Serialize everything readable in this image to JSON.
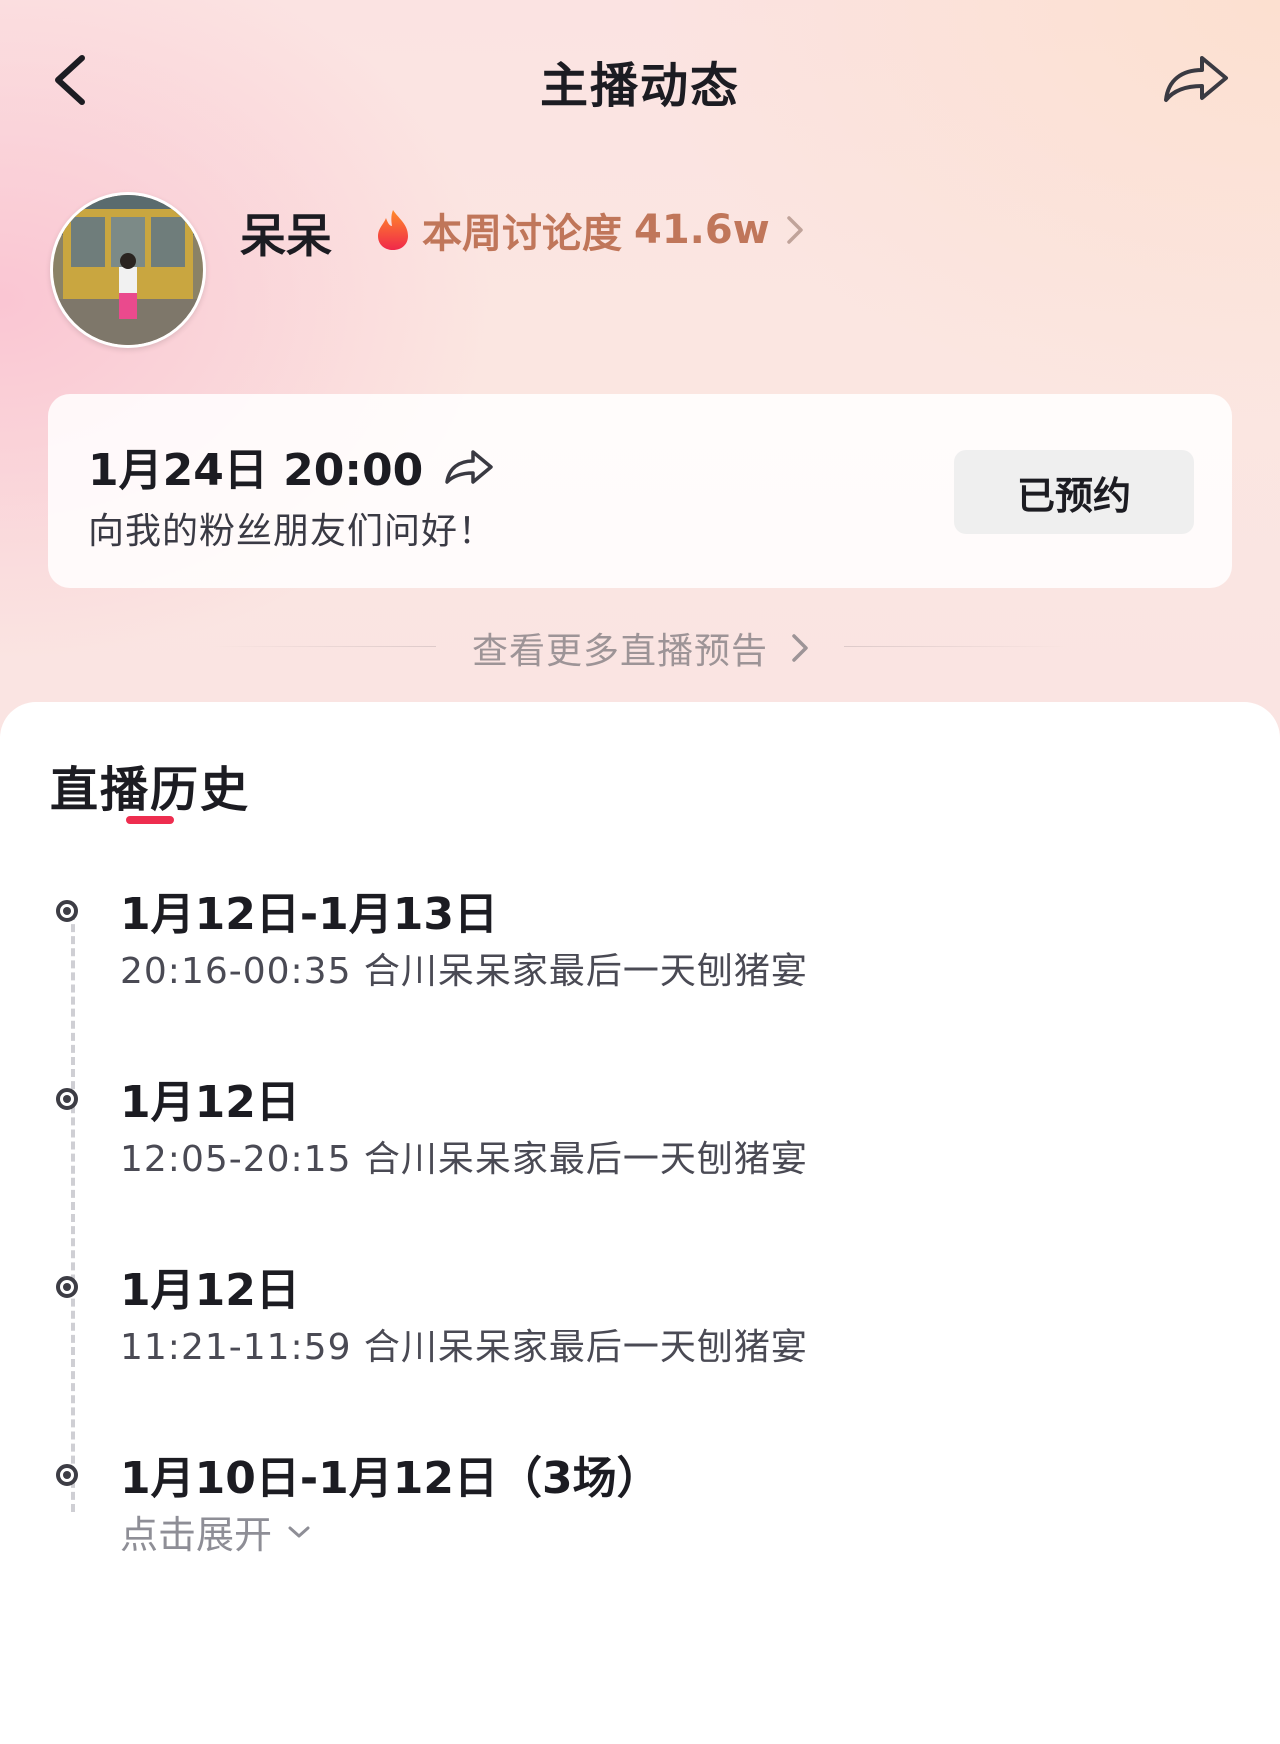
{
  "header": {
    "title": "主播动态",
    "back_icon": "chevron-left-icon",
    "share_icon": "share-icon"
  },
  "profile": {
    "name": "呆呆",
    "hot_icon": "flame-icon",
    "hot_label": "本周讨论度",
    "hot_value": "41.6w"
  },
  "preview": {
    "time": "1月24日 20:00",
    "message": "向我的粉丝朋友们问好！",
    "reserve_label": "已预约"
  },
  "more_previews": {
    "label": "查看更多直播预告"
  },
  "history": {
    "title": "直播历史",
    "entries": [
      {
        "date": "1月12日-1月13日",
        "desc": "20:16-00:35 合川呆呆家最后一天刨猪宴"
      },
      {
        "date": "1月12日",
        "desc": "12:05-20:15 合川呆呆家最后一天刨猪宴"
      },
      {
        "date": "1月12日",
        "desc": "11:21-11:59 合川呆呆家最后一天刨猪宴"
      },
      {
        "date": "1月10日-1月12日（3场）",
        "expand_label": "点击展开"
      }
    ]
  },
  "colors": {
    "accent": "#ee2d4f",
    "hot_text": "#c0765a",
    "reserve_bg": "#efefef"
  }
}
